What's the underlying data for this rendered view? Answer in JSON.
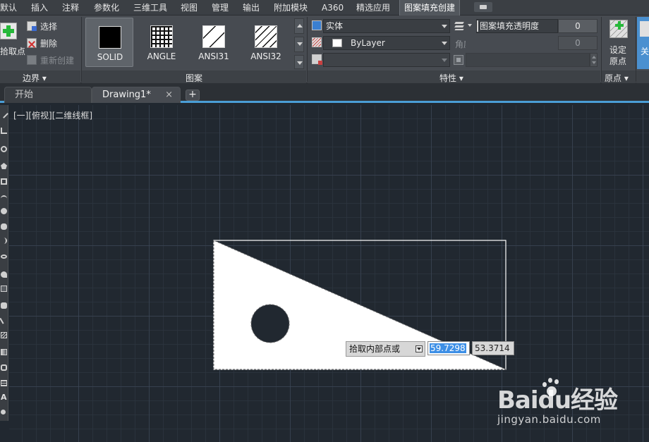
{
  "ribbon_tabs": [
    {
      "label": "默认",
      "active": false
    },
    {
      "label": "插入",
      "active": false
    },
    {
      "label": "注释",
      "active": false
    },
    {
      "label": "参数化",
      "active": false
    },
    {
      "label": "三维工具",
      "active": false
    },
    {
      "label": "视图",
      "active": false
    },
    {
      "label": "管理",
      "active": false
    },
    {
      "label": "输出",
      "active": false
    },
    {
      "label": "附加模块",
      "active": false
    },
    {
      "label": "A360",
      "active": false
    },
    {
      "label": "精选应用",
      "active": false
    },
    {
      "label": "图案填充创建",
      "active": true
    }
  ],
  "boundary_panel": {
    "title": "边界",
    "pick_points": "拾取点",
    "select": "选择",
    "remove": "删除",
    "recreate": "重新创建"
  },
  "pattern_panel": {
    "title": "图案",
    "patterns": [
      {
        "label": "SOLID",
        "selected": true
      },
      {
        "label": "ANGLE",
        "selected": false
      },
      {
        "label": "ANSI31",
        "selected": false
      },
      {
        "label": "ANSI32",
        "selected": false
      }
    ]
  },
  "properties_panel": {
    "title": "特性",
    "hatch_type": "实体",
    "color": "ByLayer",
    "transparency_label": "图案填充透明度",
    "transparency_value": "0",
    "angle_label": "角度",
    "angle_value": "0"
  },
  "origin_panel": {
    "title": "原点",
    "set_origin": "设定原点",
    "set_origin_line1": "设定",
    "set_origin_line2": "原点"
  },
  "close_panel": {
    "partial_label": "关"
  },
  "file_tabs": [
    {
      "label": "开始",
      "active": false
    },
    {
      "label": "Drawing1*",
      "active": true,
      "close": "×"
    }
  ],
  "file_tab_add": "+",
  "viewport_label": "[一][俯视][二维线框]",
  "dynamic_input": {
    "prompt": "拾取内部点或",
    "value1": "59.7298",
    "value2": "53.3714"
  },
  "watermark": {
    "brand": "Baidu经验",
    "url": "jingyan.baidu.com"
  },
  "colors": {
    "canvas": "#212830",
    "ribbon": "#474b51",
    "accent": "#4a9ed6",
    "highlight": "#3d8fe6"
  }
}
